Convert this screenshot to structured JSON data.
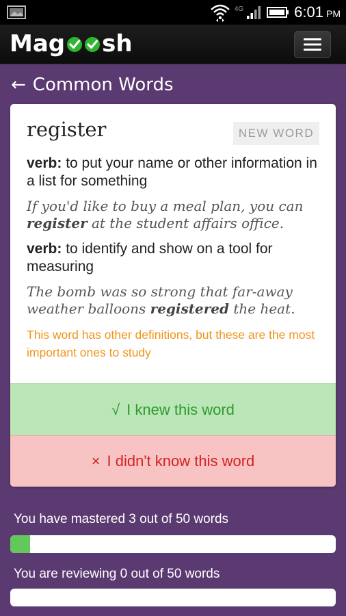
{
  "status_bar": {
    "network": "4G",
    "time": "6:01",
    "ampm": "PM"
  },
  "app_bar": {
    "logo_prefix": "Mag",
    "logo_suffix": "sh"
  },
  "page": {
    "title": "Common Words"
  },
  "card": {
    "word": "register",
    "badge": "NEW WORD",
    "definitions": [
      {
        "pos": "verb:",
        "text": " to put your name or other information in a list for something",
        "example_before": "If you'd like to buy a meal plan, you can ",
        "example_highlight": "register",
        "example_after": " at the student affairs office."
      },
      {
        "pos": "verb:",
        "text": " to identify and show on a tool for measuring",
        "example_before": "The bomb was so strong that far-away weather balloons ",
        "example_highlight": "registered",
        "example_after": " the heat."
      }
    ],
    "note": "This word has other definitions, but these are the most important ones to study",
    "knew_symbol": "√",
    "knew_label": "I knew this word",
    "didnt_symbol": "×",
    "didnt_label": "I didn't know this word"
  },
  "progress": {
    "mastered_label": "You have mastered 3 out of 50 words",
    "mastered_fraction": 0.06,
    "reviewing_label": "You are reviewing 0 out of 50 words",
    "reviewing_fraction": 0
  },
  "colors": {
    "background": "#5b3a71",
    "knew_bg": "#bbe6b7",
    "knew_text": "#2e9a2e",
    "didnt_bg": "#f8c3c3",
    "didnt_text": "#d32222",
    "note_text": "#f0941a",
    "progress_fill": "#62c85a",
    "logo_check": "#2fb52f"
  }
}
